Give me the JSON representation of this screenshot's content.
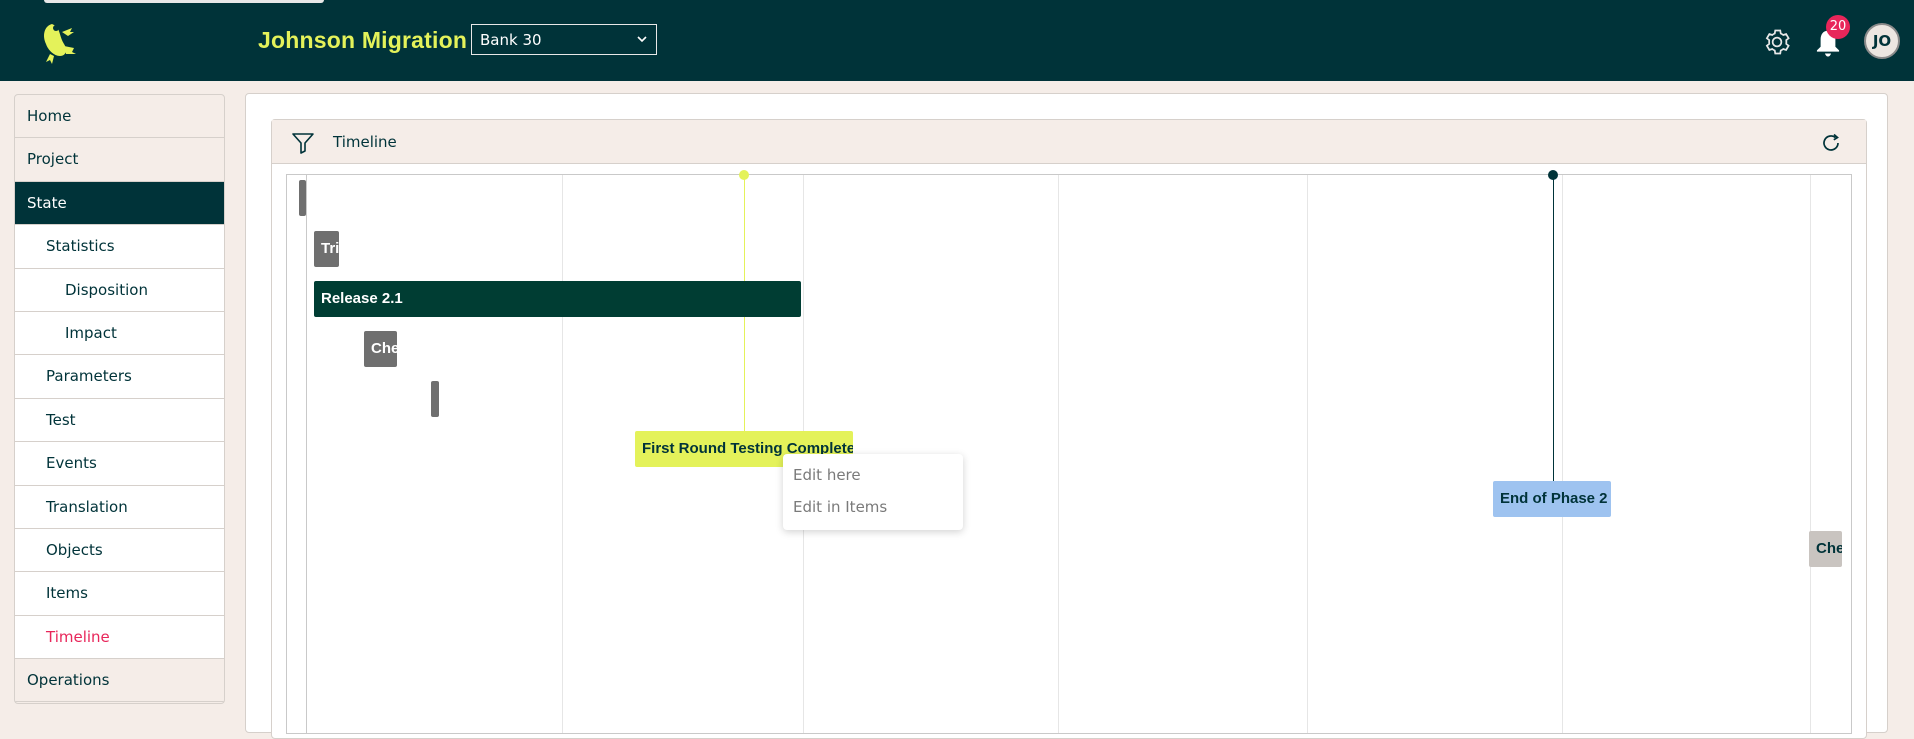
{
  "header": {
    "app_title": "Johnson Migration",
    "bank_selected": "Bank 30",
    "notification_count": "20",
    "user_initials": "JO"
  },
  "sidebar": {
    "items": [
      {
        "label": "Home",
        "level": 1
      },
      {
        "label": "Project",
        "level": 1
      },
      {
        "label": "State",
        "level": 1,
        "active": true
      },
      {
        "label": "Statistics",
        "level": 2
      },
      {
        "label": "Disposition",
        "level": 3
      },
      {
        "label": "Impact",
        "level": 3
      },
      {
        "label": "Parameters",
        "level": 2
      },
      {
        "label": "Test",
        "level": 2
      },
      {
        "label": "Events",
        "level": 2
      },
      {
        "label": "Translation",
        "level": 2
      },
      {
        "label": "Objects",
        "level": 2
      },
      {
        "label": "Items",
        "level": 2
      },
      {
        "label": "Timeline",
        "level": 2,
        "current": true
      },
      {
        "label": "Operations",
        "level": 1
      }
    ]
  },
  "timeline": {
    "title": "Timeline",
    "bars": [
      {
        "label": "Tri"
      },
      {
        "label": "Release 2.1"
      },
      {
        "label": "Che"
      },
      {
        "label": "Che"
      }
    ],
    "milestones": [
      {
        "label": "First Round Testing Complete"
      },
      {
        "label": "End of Phase 2"
      }
    ]
  },
  "context_menu": {
    "items": [
      "Edit here",
      "Edit in Items"
    ]
  },
  "colors": {
    "header_bg": "#003339",
    "accent_yellow": "#e4f25a",
    "active_nav": "#003339",
    "current_link": "#e8265a",
    "release_bar": "#003d33",
    "milestone_blue": "#9ec3f0"
  }
}
